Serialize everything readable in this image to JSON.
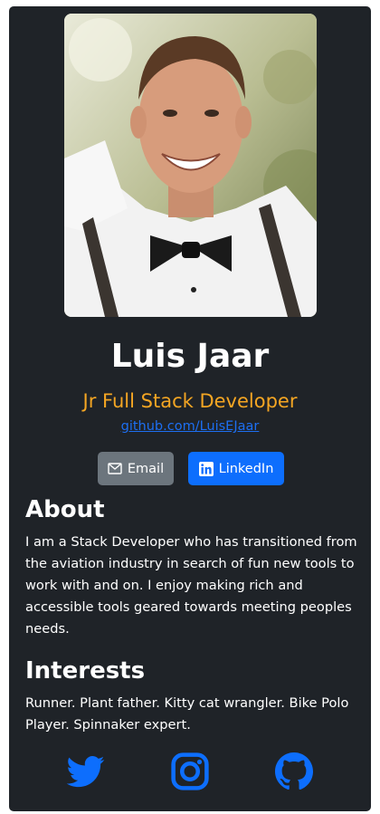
{
  "profile": {
    "name": "Luis Jaar",
    "role": "Jr Full Stack Developer",
    "github_link": "github.com/LuisEJaar"
  },
  "buttons": {
    "email_label": "Email",
    "linkedin_label": "LinkedIn"
  },
  "about": {
    "title": "About",
    "text": "I am a Stack Developer who has transitioned from the aviation industry in search of fun new tools to work with and on. I enjoy making rich and accessible tools geared towards meeting peoples needs."
  },
  "interests": {
    "title": "Interests",
    "text": "Runner. Plant father. Kitty cat wrangler. Bike Polo Player. Spinnaker expert."
  },
  "social_icons": [
    "twitter-icon",
    "instagram-icon",
    "github-icon"
  ],
  "colors": {
    "card_bg": "#1f2328",
    "accent_orange": "#f5a623",
    "link_blue": "#1d6ff2",
    "email_button": "#6c757d",
    "linkedin_button": "#0d6efd",
    "social_icon": "#0d6efd"
  }
}
